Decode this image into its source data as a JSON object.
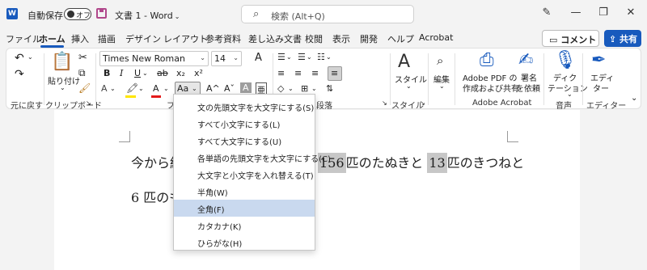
{
  "titlebar": {
    "app_logo": "W",
    "autosave_label": "自動保存",
    "autosave_state": "オフ",
    "doc_title": "文書 1 - Word",
    "search_placeholder": "検索 (Alt+Q)",
    "minimize": "—",
    "restore": "❐",
    "close": "✕",
    "pen_icon": "✎"
  },
  "tabs": [
    "ファイル",
    "ホーム",
    "挿入",
    "描画",
    "デザイン",
    "レイアウト",
    "参考資料",
    "差し込み文書",
    "校閲",
    "表示",
    "開発",
    "ヘルプ",
    "Acrobat"
  ],
  "active_tab": "ホーム",
  "comment_label": "コメント",
  "share_label": "共有",
  "ribbon": {
    "undo_label": "元に戻す",
    "clipboard_label": "クリップボード",
    "paste_label": "貼り付け",
    "font_name": "Times New Roman",
    "font_size": "14",
    "font_group_label": "フ",
    "paragraph_label": "段落",
    "style_label": "スタイル",
    "style_btn": "スタイル",
    "edit_btn": "編集",
    "adobe_pdf_line1": "Adobe PDF の",
    "adobe_pdf_line2": "作成および共有",
    "sign_line1": "署名",
    "sign_line2": "を依頼",
    "adobe_group_label": "Adobe Acrobat",
    "dictate_line1": "ディク",
    "dictate_line2": "テーション",
    "voice_label": "音声",
    "editor_line1": "エディ",
    "editor_line2": "ター",
    "editor_label": "エディター",
    "bold": "B",
    "italic": "I",
    "underline": "U",
    "strike": "ab",
    "subscript": "x₂",
    "superscript": "x²",
    "change_case": "Aa",
    "grow_font": "A^",
    "shrink_font": "Aˇ",
    "char_shade": "A",
    "phonetic": "亜",
    "clear_format": "A"
  },
  "document": {
    "line1_prefix": "今から紹",
    "line1_num1": "156",
    "line1_mid": "匹のたぬきと",
    "line1_num2": "13",
    "line1_suffix": "匹のきつねと",
    "line2": "6 匹のも"
  },
  "change_case_menu": {
    "items": [
      "文の先頭文字を大文字にする(S)",
      "すべて小文字にする(L)",
      "すべて大文字にする(U)",
      "各単語の先頭文字を大文字にする(C)",
      "大文字と小文字を入れ替える(T)",
      "半角(W)",
      "全角(F)",
      "カタカナ(K)",
      "ひらがな(H)"
    ],
    "hovered_index": 6
  },
  "colors": {
    "accent": "#185abd",
    "hover": "#c9d9ef",
    "highlight": "#c7c7c7"
  }
}
